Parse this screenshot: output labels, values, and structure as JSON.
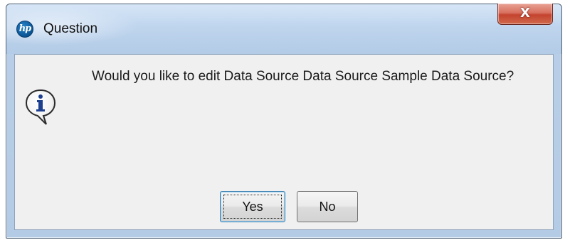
{
  "window": {
    "title": "Question",
    "app_icon_label": "hp",
    "close_glyph": "X",
    "accent_close": "#c4432f",
    "titlebar_color": "#c9dcf2"
  },
  "dialog": {
    "icon": "information-speech-bubble-icon",
    "message": "Would you like to edit Data Source Data Source Sample Data Source?",
    "buttons": {
      "yes_label": "Yes",
      "no_label": "No"
    }
  }
}
